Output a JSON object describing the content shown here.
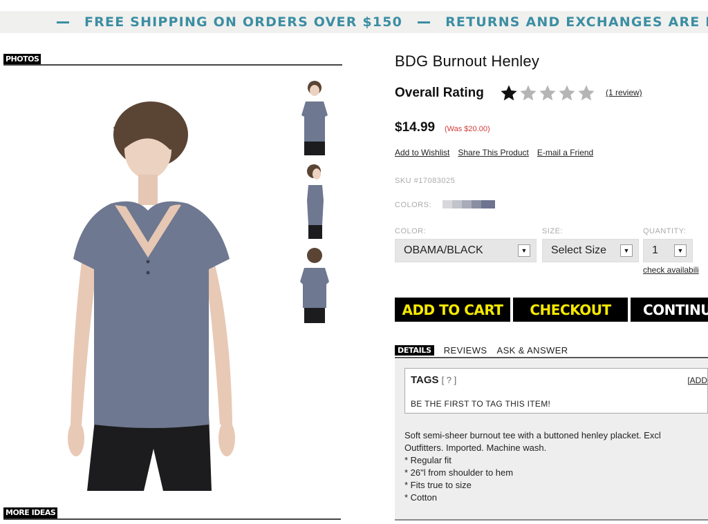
{
  "banner": {
    "left_text": "FREE SHIPPING ON ORDERS OVER $150",
    "right_text": "RETURNS AND EXCHANGES ARE FRE"
  },
  "photos_section": {
    "label": "PHOTOS"
  },
  "more_ideas_section": {
    "label": "MORE IDEAS"
  },
  "product": {
    "title": "BDG Burnout Henley",
    "rating_label": "Overall Rating",
    "rating_value": 1,
    "rating_max": 5,
    "review_link": "(1 review)",
    "price": "$14.99",
    "was_price": "(Was $20.00)",
    "actions": [
      "Add to Wishlist",
      "Share This Product",
      "E-mail a Friend"
    ],
    "sku": "SKU #17083025",
    "colors_label": "COLORS:",
    "color_label": "COLOR:",
    "color_value": "OBAMA/BLACK",
    "size_label": "SIZE:",
    "size_value": "Select Size",
    "quantity_label": "QUANTITY:",
    "quantity_value": "1",
    "check_availability": "check availabili"
  },
  "buttons": {
    "add_to_cart": "ADD TO CART",
    "checkout": "CHECKOUT",
    "continue": "CONTINU"
  },
  "tabs": {
    "details": "DETAILS",
    "reviews": "REVIEWS",
    "ask": "ASK & ANSWER"
  },
  "tags": {
    "title": "TAGS",
    "help": "[ ? ]",
    "add": "[ADD",
    "message": "BE THE FIRST TO TAG THIS ITEM!"
  },
  "description": {
    "lines": [
      "Soft semi-sheer burnout tee with a buttoned henley placket. Excl",
      "Outfitters. Imported. Machine wash.",
      "* Regular fit",
      "* 26\"l from shoulder to hem",
      "* Fits true to size",
      "* Cotton"
    ]
  },
  "colors": {
    "banner_text": "#3b8ea3",
    "accent_yellow": "#f5e800",
    "was_price": "#d23b3b",
    "swatches": [
      "#d8d8dc",
      "#c2c4cc",
      "#a9acb8",
      "#8b8fa3",
      "#6e7390"
    ]
  }
}
